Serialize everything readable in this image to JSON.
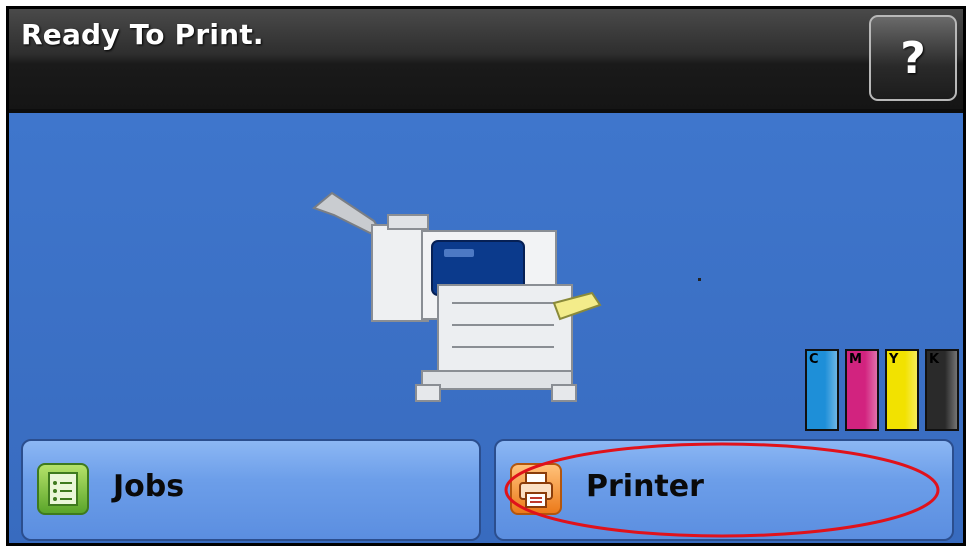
{
  "header": {
    "status_title": "Ready To Print.",
    "help_label": "?"
  },
  "toner": [
    {
      "label": "C",
      "color": "#1e8fd8",
      "level": 1.0
    },
    {
      "label": "M",
      "color": "#d2237f",
      "level": 1.0
    },
    {
      "label": "Y",
      "color": "#f2e200",
      "level": 1.0
    },
    {
      "label": "K",
      "color": "#2a2a2a",
      "level": 1.0
    }
  ],
  "buttons": {
    "jobs_label": "Jobs",
    "printer_label": "Printer"
  },
  "annotation_color": "#e0121b"
}
